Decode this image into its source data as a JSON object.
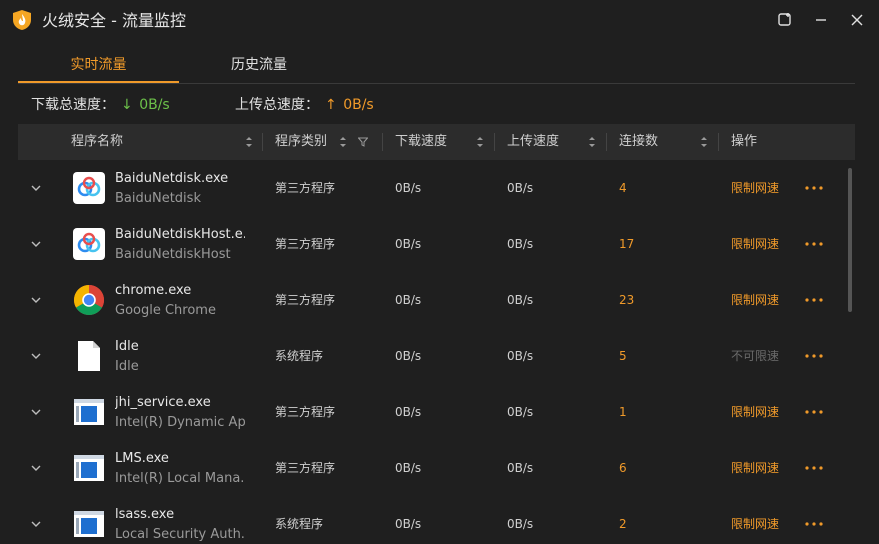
{
  "window": {
    "title": "火绒安全 - 流量监控"
  },
  "tabs": [
    {
      "label": "实时流量",
      "active": true
    },
    {
      "label": "历史流量",
      "active": false
    }
  ],
  "summary": {
    "download_label": "下载总速度：",
    "download_arrow": "↓",
    "download_value": "0B/s",
    "upload_label": "上传总速度：",
    "upload_arrow": "↑",
    "upload_value": "0B/s"
  },
  "columns": {
    "name": "程序名称",
    "type": "程序类别",
    "download": "下载速度",
    "upload": "上传速度",
    "connections": "连接数",
    "action": "操作"
  },
  "rows": [
    {
      "name": "BaiduNetdisk.exe",
      "desc": "BaiduNetdisk",
      "type": "第三方程序",
      "down": "0B/s",
      "up": "0B/s",
      "conn": "4",
      "action": "限制网速",
      "action_enabled": true,
      "icon": "baidu-netdisk-icon"
    },
    {
      "name": "BaiduNetdiskHost.e...",
      "desc": "BaiduNetdiskHost",
      "type": "第三方程序",
      "down": "0B/s",
      "up": "0B/s",
      "conn": "17",
      "action": "限制网速",
      "action_enabled": true,
      "icon": "baidu-netdisk-icon"
    },
    {
      "name": "chrome.exe",
      "desc": "Google Chrome",
      "type": "第三方程序",
      "down": "0B/s",
      "up": "0B/s",
      "conn": "23",
      "action": "限制网速",
      "action_enabled": true,
      "icon": "chrome-icon"
    },
    {
      "name": "Idle",
      "desc": "Idle",
      "type": "系统程序",
      "down": "0B/s",
      "up": "0B/s",
      "conn": "5",
      "action": "不可限速",
      "action_enabled": false,
      "icon": "blank-file-icon"
    },
    {
      "name": "jhi_service.exe",
      "desc": "Intel(R) Dynamic Ap...",
      "type": "第三方程序",
      "down": "0B/s",
      "up": "0B/s",
      "conn": "1",
      "action": "限制网速",
      "action_enabled": true,
      "icon": "window-app-icon"
    },
    {
      "name": "LMS.exe",
      "desc": "Intel(R) Local Mana...",
      "type": "第三方程序",
      "down": "0B/s",
      "up": "0B/s",
      "conn": "6",
      "action": "限制网速",
      "action_enabled": true,
      "icon": "window-app-icon"
    },
    {
      "name": "lsass.exe",
      "desc": "Local Security Auth...",
      "type": "系统程序",
      "down": "0B/s",
      "up": "0B/s",
      "conn": "2",
      "action": "限制网速",
      "action_enabled": true,
      "icon": "window-app-icon"
    }
  ],
  "colors": {
    "accent": "#f09a2a",
    "download": "#6cc04a",
    "background": "#1f1f1f",
    "header": "#2c2c2c"
  }
}
